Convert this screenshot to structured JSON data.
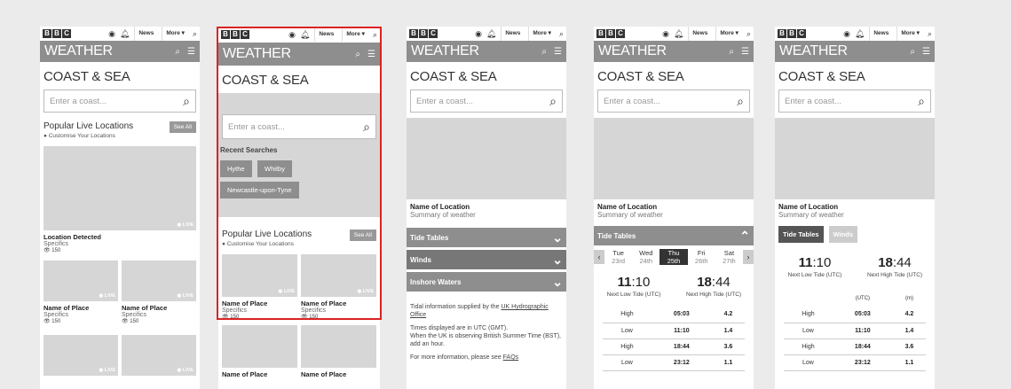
{
  "common": {
    "bbc": [
      "B",
      "B",
      "C"
    ],
    "news": "News",
    "more": "More",
    "weather": "WEATHER",
    "page_title": "COAST & SEA",
    "search_placeholder": "Enter a coast..."
  },
  "s1": {
    "popular_title": "Popular Live Locations",
    "customise": "Customise Your Locations",
    "see_all": "See All",
    "live": "LIVE",
    "detected_name": "Location Detected",
    "specifics": "Specifics",
    "count": "150",
    "place_name": "Name of Place"
  },
  "s2": {
    "recent_title": "Recent Searches",
    "chips": [
      "Hythe",
      "Whitby",
      "Newcastle-upon-Tyne"
    ],
    "popular_title": "Popular Live Locations",
    "customise": "Customise Your Locations",
    "see_all": "See All",
    "place_name": "Name of Place",
    "specifics": "Specifics",
    "count": "150",
    "live": "LIVE"
  },
  "s3": {
    "loc_name": "Name of Location",
    "loc_summary": "Summary of weather",
    "acc": [
      "Tide Tables",
      "Winds",
      "Inshore Waters"
    ],
    "info1_pre": "Tidal information supplied by the ",
    "info1_link": "UK Hydrographic Office",
    "info2": "Times displayed are in UTC (GMT).",
    "info3": "When the UK is observing British Summer Time (BST), add an hour.",
    "info4_pre": "For more information, please see ",
    "info4_link": "FAQs"
  },
  "s4": {
    "loc_name": "Name of Location",
    "loc_summary": "Summary of weather",
    "acc_title": "Tide Tables",
    "days": [
      {
        "d": "Tue",
        "n": "23rd"
      },
      {
        "d": "Wed",
        "n": "24th"
      },
      {
        "d": "Thu",
        "n": "25th"
      },
      {
        "d": "Fri",
        "n": "26th"
      },
      {
        "d": "Sat",
        "n": "27th"
      }
    ],
    "low_time_h": "11",
    "low_time_m": ":10",
    "low_label": "Next Low Tide (UTC)",
    "high_time_h": "18",
    "high_time_m": ":44",
    "high_label": "Next High Tide (UTC)",
    "rows": [
      {
        "t": "High",
        "time": "05:03",
        "h": "4.2"
      },
      {
        "t": "Low",
        "time": "11:10",
        "h": "1.4"
      },
      {
        "t": "High",
        "time": "18:44",
        "h": "3.6"
      },
      {
        "t": "Low",
        "time": "23:12",
        "h": "1.1"
      }
    ]
  },
  "s5": {
    "loc_name": "Name of Location",
    "loc_summary": "Summary of weather",
    "tab_on": "Tide Tables",
    "tab_off": "Winds",
    "low_time_h": "11",
    "low_time_m": ":10",
    "low_label": "Next Low Tide (UTC)",
    "high_time_h": "18",
    "high_time_m": ":44",
    "high_label": "Next High Tide (UTC)",
    "col_utc": "(UTC)",
    "col_m": "(m)",
    "rows": [
      {
        "t": "High",
        "time": "05:03",
        "h": "4.2"
      },
      {
        "t": "Low",
        "time": "11:10",
        "h": "1.4"
      },
      {
        "t": "High",
        "time": "18:44",
        "h": "3.6"
      },
      {
        "t": "Low",
        "time": "23:12",
        "h": "1.1"
      }
    ]
  }
}
